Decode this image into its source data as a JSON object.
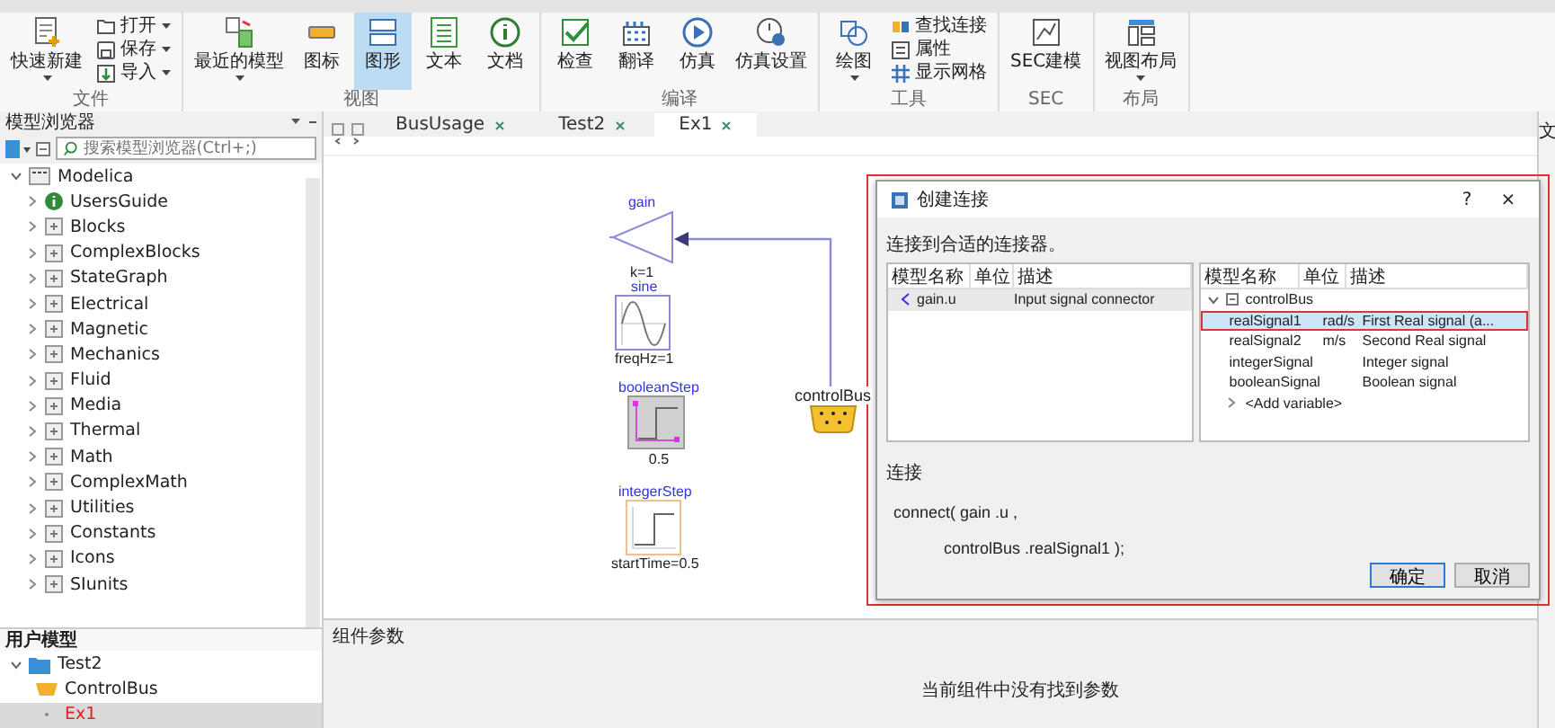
{
  "ribbon": {
    "groups": [
      {
        "label": "文件",
        "items": [
          {
            "kind": "large",
            "label": "快速新建",
            "dropdown": true,
            "selected": false
          },
          {
            "kind": "small",
            "label": "打开",
            "dropdown": true
          },
          {
            "kind": "small",
            "label": "保存",
            "dropdown": true
          },
          {
            "kind": "small",
            "label": "导入",
            "dropdown": true
          }
        ]
      },
      {
        "label": "视图",
        "items": [
          {
            "kind": "large",
            "label": "最近的模型",
            "dropdown": true,
            "selected": false
          },
          {
            "kind": "large",
            "label": "图标",
            "dropdown": false,
            "selected": false
          },
          {
            "kind": "large",
            "label": "图形",
            "dropdown": false,
            "selected": true
          },
          {
            "kind": "large",
            "label": "文本",
            "dropdown": false,
            "selected": false
          },
          {
            "kind": "large",
            "label": "文档",
            "dropdown": false,
            "selected": false
          }
        ]
      },
      {
        "label": "编译",
        "items": [
          {
            "kind": "large",
            "label": "检查",
            "dropdown": false,
            "selected": false
          },
          {
            "kind": "large",
            "label": "翻译",
            "dropdown": false,
            "selected": false
          },
          {
            "kind": "large",
            "label": "仿真",
            "dropdown": false,
            "selected": false
          },
          {
            "kind": "large",
            "label": "仿真设置",
            "dropdown": false,
            "selected": false
          }
        ]
      },
      {
        "label": "工具",
        "items": [
          {
            "kind": "large",
            "label": "绘图",
            "dropdown": true,
            "selected": false
          },
          {
            "kind": "small",
            "label": "查找连接",
            "dropdown": false
          },
          {
            "kind": "small",
            "label": "属性",
            "dropdown": false
          },
          {
            "kind": "small",
            "label": "显示网格",
            "dropdown": false
          }
        ]
      },
      {
        "label": "SEC",
        "items": [
          {
            "kind": "large",
            "label": "SEC建模",
            "dropdown": false,
            "selected": false
          }
        ]
      },
      {
        "label": "布局",
        "items": [
          {
            "kind": "large",
            "label": "视图布局",
            "dropdown": true,
            "selected": false
          }
        ]
      }
    ]
  },
  "model_browser": {
    "title": "模型浏览器",
    "search": {
      "placeholder": "搜索模型浏览器(Ctrl+;)"
    },
    "tree": {
      "label": "Modelica",
      "expanded": true,
      "children": [
        {
          "label": "UsersGuide",
          "expanded": false
        },
        {
          "label": "Blocks",
          "expanded": false
        },
        {
          "label": "ComplexBlocks",
          "expanded": false
        },
        {
          "label": "StateGraph",
          "expanded": false
        },
        {
          "label": "Electrical",
          "expanded": false
        },
        {
          "label": "Magnetic",
          "expanded": false
        },
        {
          "label": "Mechanics",
          "expanded": false
        },
        {
          "label": "Fluid",
          "expanded": false
        },
        {
          "label": "Media",
          "expanded": false
        },
        {
          "label": "Thermal",
          "expanded": false
        },
        {
          "label": "Math",
          "expanded": false
        },
        {
          "label": "ComplexMath",
          "expanded": false
        },
        {
          "label": "Utilities",
          "expanded": false
        },
        {
          "label": "Constants",
          "expanded": false
        },
        {
          "label": "Icons",
          "expanded": false
        },
        {
          "label": "SIunits",
          "expanded": false
        }
      ]
    }
  },
  "user_models": {
    "title": "用户模型",
    "tree": {
      "label": "Test2",
      "expanded": true,
      "children": [
        {
          "label": "ControlBus",
          "selected": false
        },
        {
          "label": "Ex1",
          "selected": true
        }
      ]
    }
  },
  "tabs": [
    {
      "label": "BusUsage",
      "selected": false
    },
    {
      "label": "Test2",
      "selected": false
    },
    {
      "label": "Ex1",
      "selected": true
    }
  ],
  "diagram": {
    "components": [
      {
        "kind": "gain",
        "name": "gain",
        "parameter": "k=1"
      },
      {
        "kind": "sine",
        "name": "sine",
        "parameter": "freqHz=1"
      },
      {
        "kind": "booleanStep",
        "name": "booleanStep",
        "parameter": "0.5"
      },
      {
        "kind": "integerStep",
        "name": "integerStep",
        "parameter": "startTime=0.5"
      },
      {
        "kind": "bus",
        "name": "controlBus"
      }
    ]
  },
  "parameters_panel": {
    "title": "组件参数",
    "message": "当前组件中没有找到参数"
  },
  "right_panel": {
    "title": "文"
  },
  "dialog": {
    "title": "创建连接",
    "help": "?",
    "close": "×",
    "highlighted": true,
    "instruction": "连接到合适的连接器。",
    "left_columns": [
      "模型名称",
      "单位",
      "描述"
    ],
    "left_rows": [
      {
        "name": "gain.u",
        "description": "Input signal connector",
        "selected": true
      }
    ],
    "right_columns": [
      "模型名称",
      "单位",
      "描述"
    ],
    "right_tree": {
      "label": "controlBus",
      "expanded": true,
      "children": [
        {
          "name": "realSignal1",
          "unit": "rad/s",
          "description": "First Real signal (a...",
          "selected": true,
          "highlighted": true
        },
        {
          "name": "realSignal2",
          "unit": "m/s",
          "description": "Second Real signal",
          "selected": false,
          "highlighted": false
        },
        {
          "name": "integerSignal",
          "description": "Integer signal",
          "selected": false,
          "highlighted": false
        },
        {
          "name": "booleanSignal",
          "description": "Boolean signal",
          "selected": false,
          "highlighted": false
        },
        {
          "kind": "add_variable",
          "name": "<Add variable>"
        }
      ]
    },
    "connection_label": "连接",
    "code": [
      "connect( gain .u ,",
      "controlBus .realSignal1 );"
    ],
    "buttons": [
      {
        "label": "确定",
        "default": true
      },
      {
        "label": "取消",
        "default": false
      }
    ]
  }
}
